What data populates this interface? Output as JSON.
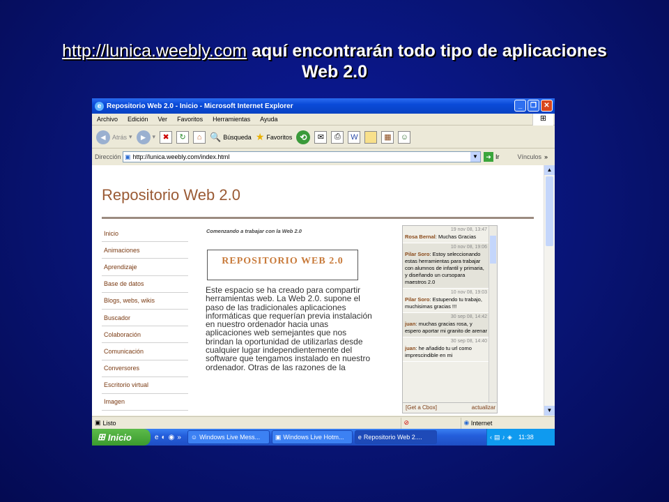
{
  "slide": {
    "link": "http://lunica.weebly.com",
    "text": " aquí encontrarán todo tipo de aplicaciones",
    "line2": "Web 2.0"
  },
  "window": {
    "title": "Repositorio Web 2.0 - Inicio - Microsoft Internet Explorer"
  },
  "menu": [
    "Archivo",
    "Edición",
    "Ver",
    "Favoritos",
    "Herramientas",
    "Ayuda"
  ],
  "toolbar": {
    "back": "Atrás",
    "search": "Búsqueda",
    "favorites": "Favoritos"
  },
  "address": {
    "label": "Dirección",
    "url": "http://lunica.weebly.com/index.html",
    "go": "Ir",
    "links": "Vínculos"
  },
  "site": {
    "title": "Repositorio Web 2.0",
    "nav": [
      "Inicio",
      "Animaciones",
      "Aprendizaje",
      "Base de datos",
      "Blogs, webs, wikis",
      "Buscador",
      "Colaboración",
      "Comunicación",
      "Conversores",
      "Escritorio virtual",
      "Imagen"
    ],
    "intro": "Comenzando a trabajar con la Web 2.0",
    "logo": "REPOSITORIO WEB 2.0",
    "body": "Este espacio se ha creado para compartir herramientas web. La Web 2.0.  supone el paso de las tradicionales aplicaciones informáticas que requerían previa instalación en nuestro ordenador hacia unas aplicaciones web semejantes que nos brindan la oportunidad de utilizarlas desde cualquier lugar independientemente del software que tengamos instalado en nuestro ordenador. Otras de las razones de la"
  },
  "chat": {
    "messages": [
      {
        "time": "19 nov 08, 13:47",
        "author": "Rosa Bernal",
        "text": ": Muchas Gracias"
      },
      {
        "time": "10 nov 08, 19:06",
        "author": "Pilar Soro",
        "text": ": Estoy seleccionando estas herramientas para trabajar con alumnos de infantil y primaria, y diseñando un cursopara maestros 2.0"
      },
      {
        "time": "10 nov 08, 19:03",
        "author": "Pilar Soro",
        "text": ": Estupendo tu trabajo, muchisimas gracias !!!"
      },
      {
        "time": "30 sep 08, 14:42",
        "author": "juan",
        "text": ": muchas gracias rosa, y espero aportar mi granito de arenar"
      },
      {
        "time": "30 sep 08, 14:40",
        "author": "juan",
        "text": ": he añadido tu url como imprescindible en mi"
      }
    ],
    "get": "[Get a Cbox]",
    "refresh": "actualizar"
  },
  "status": {
    "text": "Listo",
    "zone": "Internet"
  },
  "taskbar": {
    "start": "Inicio",
    "tasks": [
      "Windows Live Mess...",
      "Windows Live Hotm...",
      "Repositorio Web 2...."
    ],
    "clock": "11:38"
  },
  "colors": {
    "slide_bg": "#081474",
    "xp_blue": "#245edb",
    "link_brown": "#7a3a12"
  }
}
